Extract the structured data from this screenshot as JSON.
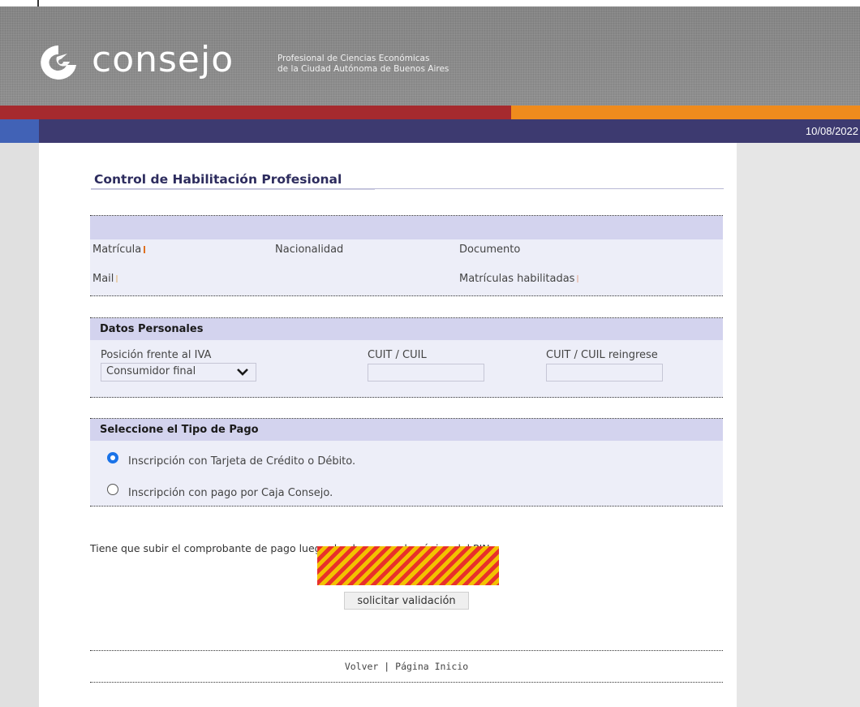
{
  "header": {
    "logo_word": "consejo",
    "tagline_line1": "Profesional de Ciencias Económicas",
    "tagline_line2": "de la Ciudad Autónoma de Buenos Aires",
    "date": "10/08/2022"
  },
  "page": {
    "title": "Control de Habilitación Profesional"
  },
  "profile_box": {
    "matricula_label": "Matrícula",
    "nacionalidad_label": "Nacionalidad",
    "documento_label": "Documento",
    "mail_label": "Mail",
    "matriculas_label": "Matrículas habilitadas"
  },
  "personal": {
    "heading": "Datos Personales",
    "iva_label": "Posición frente al IVA",
    "iva_value": "Consumidor final",
    "cuit_label": "CUIT / CUIL",
    "cuit_re_label": "CUIT / CUIL reingrese"
  },
  "payment": {
    "heading": "Seleccione el Tipo de Pago",
    "options": [
      {
        "label": "Inscripción con Tarjeta de Crédito o Débito.",
        "selected": true
      },
      {
        "label": "Inscripción con pago por Caja Consejo.",
        "selected": false
      }
    ]
  },
  "note": {
    "text": "Tiene que subir el comprobante de pago luego de abonar, en la página del PJN."
  },
  "actions": {
    "validate_label": "solicitar validación"
  },
  "footer": {
    "back_label": "Volver",
    "separator": "|",
    "home_label": "Página Inicio"
  },
  "colors": {
    "header_gray": "#8a8a8a",
    "band_red": "#a62a2e",
    "band_orange": "#ef8b1d",
    "navbar": "#3d3a70",
    "title": "#2d2c5e",
    "box_head": "#d3d3ee",
    "box_body": "#edeef8"
  }
}
